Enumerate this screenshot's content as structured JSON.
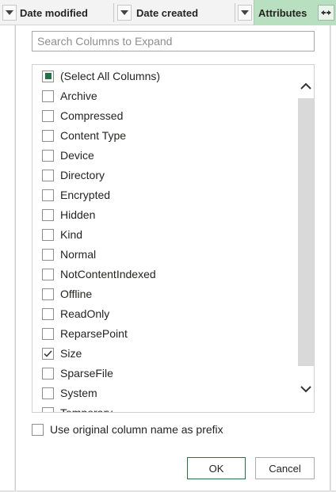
{
  "header": {
    "col1_label": "Date modified",
    "col2_label": "Date created",
    "col3_label": "Attributes",
    "accent": "#b9dfc1"
  },
  "search": {
    "placeholder": "Search Columns to Expand",
    "value": ""
  },
  "list": {
    "items": [
      {
        "label": "(Select All Columns)",
        "state": "indeterminate"
      },
      {
        "label": "Archive",
        "state": "unchecked"
      },
      {
        "label": "Compressed",
        "state": "unchecked"
      },
      {
        "label": "Content Type",
        "state": "unchecked"
      },
      {
        "label": "Device",
        "state": "unchecked"
      },
      {
        "label": "Directory",
        "state": "unchecked"
      },
      {
        "label": "Encrypted",
        "state": "unchecked"
      },
      {
        "label": "Hidden",
        "state": "unchecked"
      },
      {
        "label": "Kind",
        "state": "unchecked"
      },
      {
        "label": "Normal",
        "state": "unchecked"
      },
      {
        "label": "NotContentIndexed",
        "state": "unchecked"
      },
      {
        "label": "Offline",
        "state": "unchecked"
      },
      {
        "label": "ReadOnly",
        "state": "unchecked"
      },
      {
        "label": "ReparsePoint",
        "state": "unchecked"
      },
      {
        "label": "Size",
        "state": "checked"
      },
      {
        "label": "SparseFile",
        "state": "unchecked"
      },
      {
        "label": "System",
        "state": "unchecked"
      },
      {
        "label": "Temporary",
        "state": "unchecked"
      }
    ]
  },
  "options": {
    "prefix_label": "Use original column name as prefix",
    "prefix_checked": false
  },
  "buttons": {
    "ok": "OK",
    "cancel": "Cancel"
  },
  "colors": {
    "ok_border": "#217346",
    "indeterminate_fill": "#217346"
  }
}
